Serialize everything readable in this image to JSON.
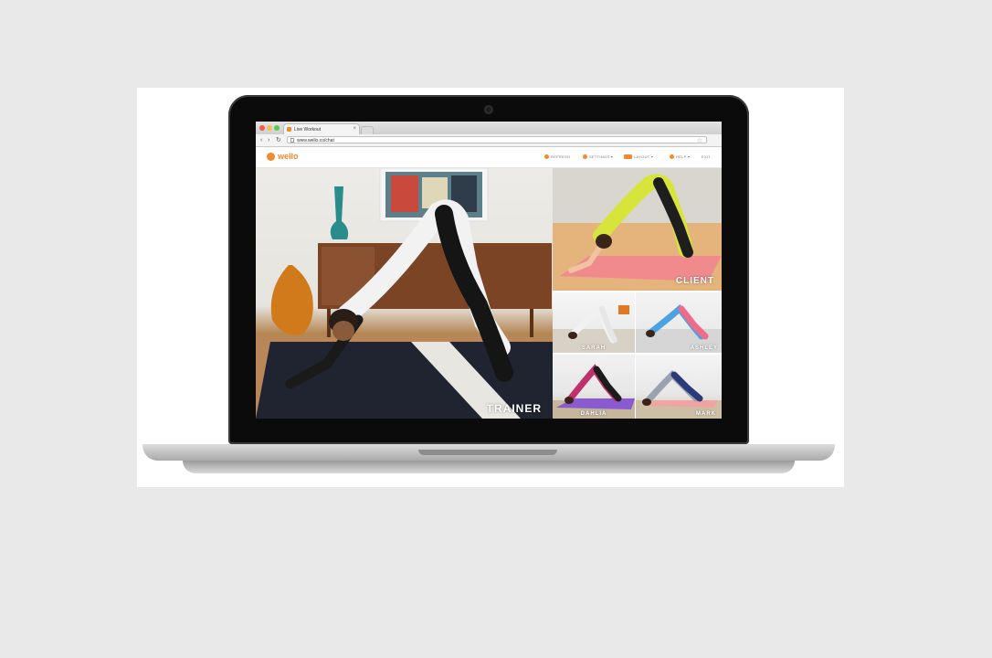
{
  "browser": {
    "tab_title": "Live Workout",
    "tab_close": "×",
    "url": "www.wello.co/chat",
    "nav": {
      "back": "‹",
      "forward": "›",
      "reload": "↻"
    },
    "bookmark": "☆"
  },
  "app": {
    "logo": "wello",
    "brand_color": "#f08a2b",
    "menu": {
      "refresh": "REFRESH",
      "settings": "SETTINGS ▾",
      "layout": "LAYOUT ▾",
      "help": "HELP ▾",
      "exit": "EXIT"
    }
  },
  "videos": {
    "trainer": "TRAINER",
    "client": "CLIENT",
    "participants": [
      "SARAH",
      "ASHLEY",
      "DAHLIA",
      "MARK"
    ]
  }
}
